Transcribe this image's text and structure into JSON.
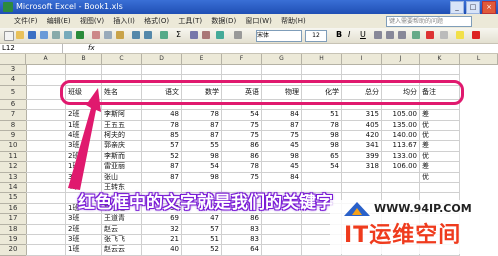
{
  "window": {
    "title": "Microsoft Excel - Book1.xls"
  },
  "menu": [
    "文件(F)",
    "编辑(E)",
    "视图(V)",
    "插入(I)",
    "格式(O)",
    "工具(T)",
    "数据(D)",
    "窗口(W)",
    "帮助(H)"
  ],
  "help_placeholder": "键入需要帮助的问题",
  "toolbar": {
    "font": "宋体",
    "size": "12"
  },
  "formula_bar": {
    "cell_ref": "L12",
    "fx": "fx"
  },
  "columns": [
    "A",
    "B",
    "C",
    "D",
    "E",
    "F",
    "G",
    "H",
    "I",
    "J",
    "K",
    "L"
  ],
  "rows": [
    {
      "n": "3",
      "cells": [
        "",
        "",
        "",
        "",
        "",
        "",
        "",
        "",
        "",
        "",
        ""
      ]
    },
    {
      "n": "4",
      "cells": [
        "",
        "",
        "",
        "",
        "",
        "",
        "",
        "",
        "",
        "",
        ""
      ]
    },
    {
      "n": "5",
      "cells": [
        "",
        "班级",
        "姓名",
        "语文",
        "数学",
        "英语",
        "物理",
        "化学",
        "总分",
        "均分",
        "备注"
      ]
    },
    {
      "n": "6",
      "cells": [
        "",
        "",
        "",
        "",
        "",
        "",
        "",
        "",
        "",
        "",
        ""
      ]
    },
    {
      "n": "7",
      "cells": [
        "",
        "2班",
        "李斯阿",
        "48",
        "78",
        "54",
        "84",
        "51",
        "315",
        "105.00",
        "差"
      ]
    },
    {
      "n": "8",
      "cells": [
        "",
        "1班",
        "王五五",
        "78",
        "87",
        "75",
        "87",
        "78",
        "405",
        "135.00",
        "优"
      ]
    },
    {
      "n": "9",
      "cells": [
        "",
        "4班",
        "柯夫的",
        "85",
        "87",
        "75",
        "75",
        "98",
        "420",
        "140.00",
        "优"
      ]
    },
    {
      "n": "10",
      "cells": [
        "",
        "3班",
        "郭亲庆",
        "57",
        "55",
        "86",
        "45",
        "98",
        "341",
        "113.67",
        "差"
      ]
    },
    {
      "n": "11",
      "cells": [
        "",
        "2班",
        "李斯而",
        "52",
        "98",
        "86",
        "98",
        "65",
        "399",
        "133.00",
        "优"
      ]
    },
    {
      "n": "12",
      "cells": [
        "",
        "1班",
        "雷亚丽",
        "87",
        "54",
        "78",
        "45",
        "54",
        "318",
        "106.00",
        "差"
      ]
    },
    {
      "n": "13",
      "cells": [
        "",
        "3班",
        "张山",
        "87",
        "98",
        "75",
        "84",
        "",
        "",
        "",
        "优"
      ]
    },
    {
      "n": "14",
      "cells": [
        "",
        "4班",
        "王转东",
        "",
        "",
        "",
        "",
        "",
        "",
        "",
        ""
      ]
    },
    {
      "n": "15",
      "cells": [
        "",
        "",
        "",
        "",
        "",
        "",
        "",
        "",
        "",
        "",
        ""
      ]
    },
    {
      "n": "16",
      "cells": [
        "",
        "1班",
        "林小姐",
        "58",
        "",
        "",
        "",
        "",
        "",
        "",
        ""
      ]
    },
    {
      "n": "17",
      "cells": [
        "",
        "3班",
        "王道青",
        "69",
        "47",
        "86",
        "",
        "",
        "",
        "",
        ""
      ]
    },
    {
      "n": "18",
      "cells": [
        "",
        "2班",
        "赵云",
        "32",
        "57",
        "83",
        "",
        "",
        "",
        "",
        ""
      ]
    },
    {
      "n": "19",
      "cells": [
        "",
        "3班",
        "张飞飞",
        "21",
        "51",
        "83",
        "",
        "",
        "",
        "",
        ""
      ]
    },
    {
      "n": "20",
      "cells": [
        "",
        "1班",
        "赵云云",
        "40",
        "52",
        "64",
        "",
        "",
        "",
        "",
        ""
      ]
    }
  ],
  "annotation": {
    "caption": "红色框中的文字就是我们的关键字"
  },
  "watermark": {
    "url": "WWW.94IP.COM",
    "brand": "IT运维空间"
  },
  "colors": {
    "highlight": "#e0196e",
    "caption_outline": "#7a1bd6",
    "brand": "#ef3b1d"
  }
}
